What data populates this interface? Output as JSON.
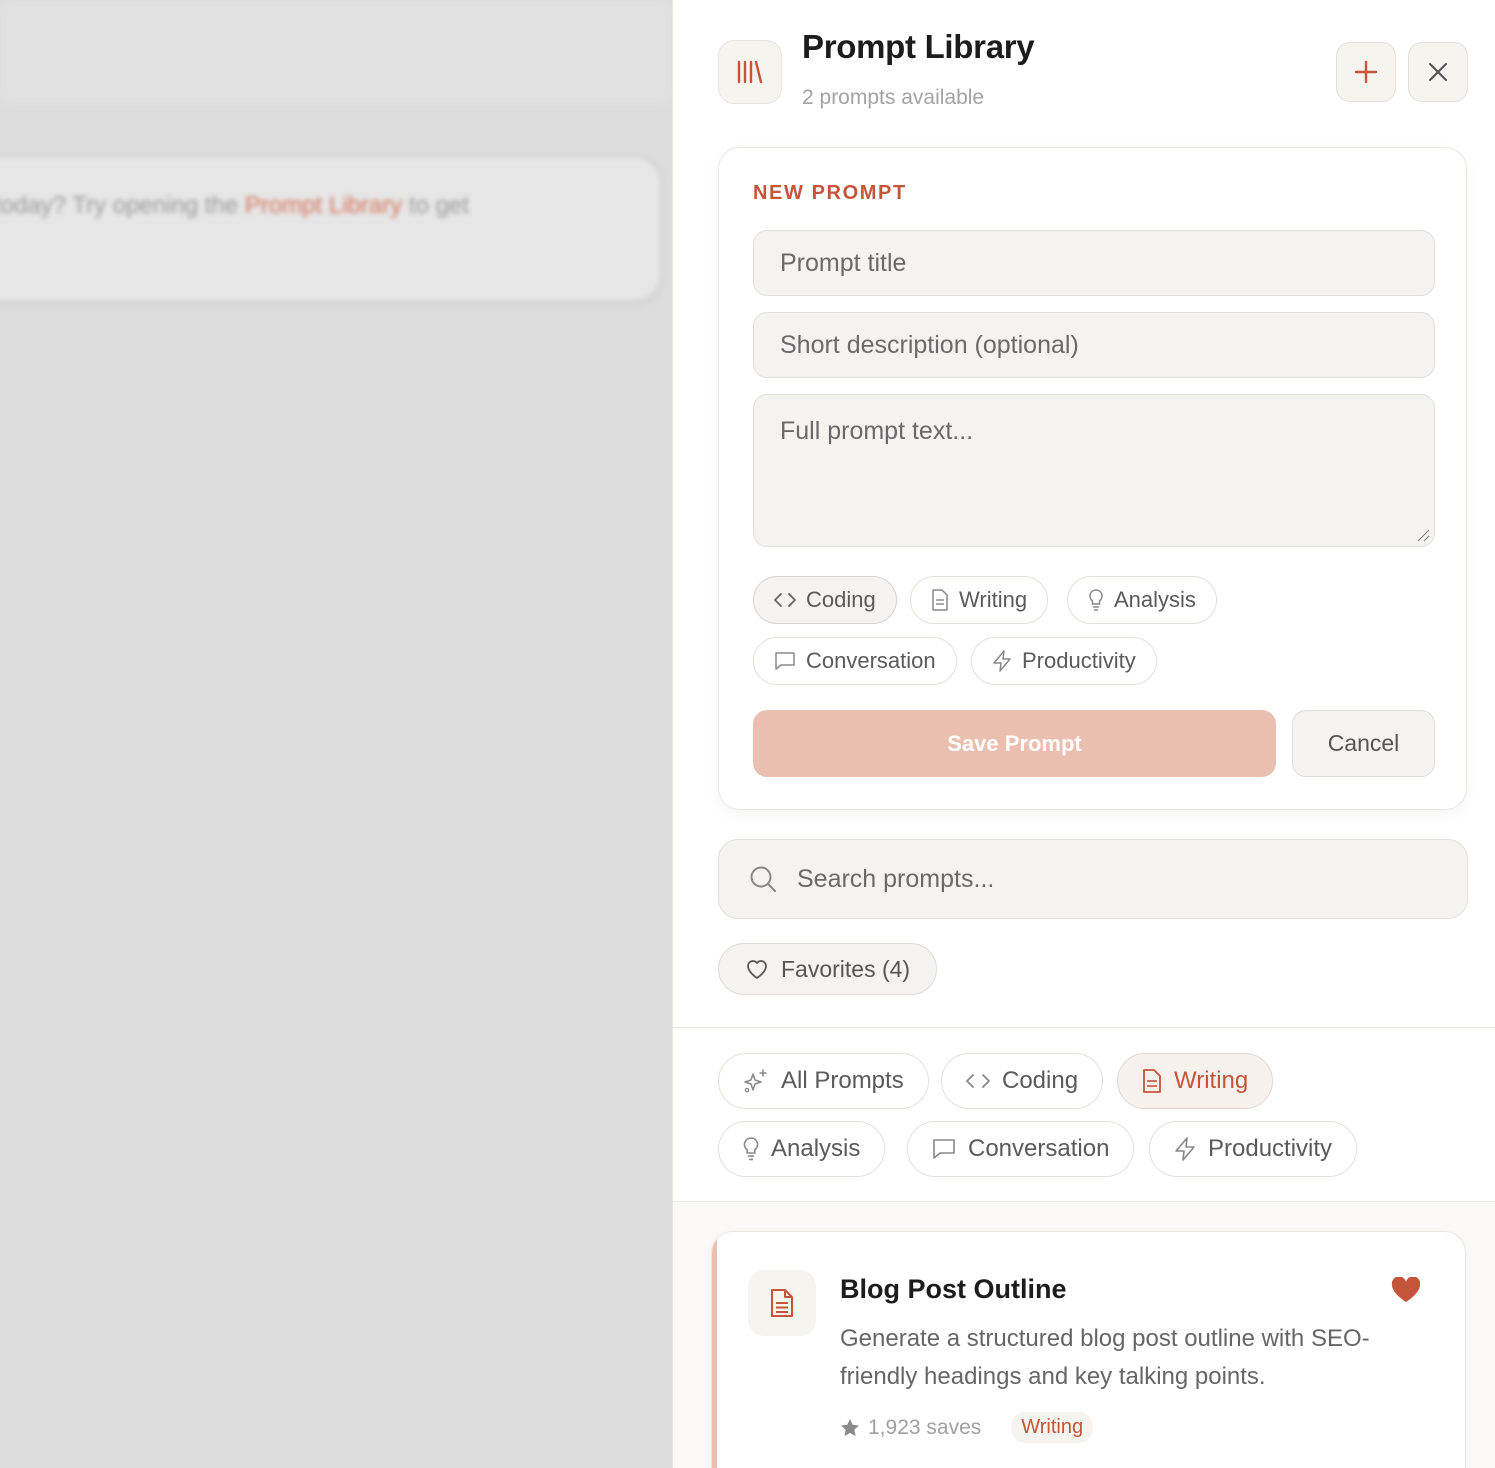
{
  "backdrop": {
    "text_before": "today? Try opening the ",
    "text_highlight": "Prompt Library",
    "text_after": " to get"
  },
  "panel": {
    "title": "Prompt Library",
    "subtitle": "2 prompts available",
    "add_icon": "plus-icon",
    "close_icon": "close-icon"
  },
  "new_prompt": {
    "label": "NEW PROMPT",
    "title_placeholder": "Prompt title",
    "desc_placeholder": "Short description (optional)",
    "text_placeholder": "Full prompt text...",
    "categories": [
      {
        "label": "Coding",
        "icon": "code-icon",
        "selected": true
      },
      {
        "label": "Writing",
        "icon": "document-icon",
        "selected": false
      },
      {
        "label": "Analysis",
        "icon": "lightbulb-icon",
        "selected": false
      },
      {
        "label": "Conversation",
        "icon": "chat-icon",
        "selected": false
      },
      {
        "label": "Productivity",
        "icon": "lightning-icon",
        "selected": false
      }
    ],
    "save_label": "Save Prompt",
    "cancel_label": "Cancel"
  },
  "search": {
    "placeholder": "Search prompts..."
  },
  "favorites": {
    "label": "Favorites (4)"
  },
  "filters": [
    {
      "label": "All Prompts",
      "icon": "sparkles-icon",
      "active": false
    },
    {
      "label": "Coding",
      "icon": "code-icon",
      "active": false
    },
    {
      "label": "Writing",
      "icon": "document-icon",
      "active": true
    },
    {
      "label": "Analysis",
      "icon": "lightbulb-icon",
      "active": false
    },
    {
      "label": "Conversation",
      "icon": "chat-icon",
      "active": false
    },
    {
      "label": "Productivity",
      "icon": "lightning-icon",
      "active": false
    }
  ],
  "prompts": [
    {
      "title": "Blog Post Outline",
      "description": "Generate a structured blog post outline with SEO-friendly headings and key talking points.",
      "saves": "1,923 saves",
      "tag": "Writing",
      "favorite": true
    }
  ],
  "colors": {
    "accent": "#c4553a",
    "accent_soft": "#ebbfb0",
    "field_bg": "#f5f3ef"
  }
}
